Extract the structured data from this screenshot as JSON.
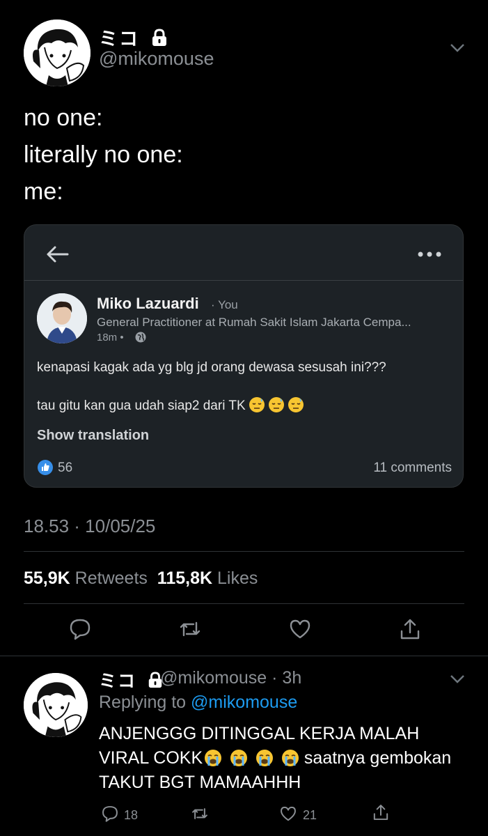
{
  "tweet": {
    "display_name": "ミコ",
    "handle": "@mikomouse",
    "text_lines": [
      "no one:",
      "literally no one:",
      "me:"
    ],
    "timestamp": "18.53 · 10/05/25",
    "retweets_count": "55,9K",
    "retweets_label": "Retweets",
    "likes_count": "115,8K",
    "likes_label": "Likes"
  },
  "linkedin_card": {
    "name": "Miko Lazuardi",
    "you_label": "· You",
    "headline": "General Practitioner at Rumah Sakit Islam Jakarta Cempa...",
    "time": "18m •",
    "body_line1": "kenapasi kagak ada yg blg jd orang dewasa sesusah ini???",
    "body_line2": "tau gitu kan gua udah siap2 dari TK",
    "show_translation": "Show translation",
    "reactions": "56",
    "comments": "11 comments"
  },
  "reply": {
    "display_name": "ミコ",
    "handle_time": "@mikomouse · 3h",
    "replying_prefix": "Replying to",
    "replying_mention": "@mikomouse",
    "text_part1": "ANJENGGG DITINGGAL KERJA MALAH VIRAL COKK",
    "text_part2": " saatnya gembokan TAKUT BGT MAMAAHHH",
    "reply_count": "18",
    "like_count": "21"
  },
  "colors": {
    "background": "#000000",
    "accent_blue": "#1d9bf0",
    "muted": "#8b8f94",
    "card_bg": "#1d2226"
  },
  "icons": [
    "lock-icon",
    "chevron-down-icon",
    "back-arrow-icon",
    "more-dots-icon",
    "globe-icon",
    "like-thumb-icon",
    "reply-icon",
    "retweet-icon",
    "heart-icon",
    "share-icon",
    "sleepy-emoji",
    "crying-emoji"
  ]
}
